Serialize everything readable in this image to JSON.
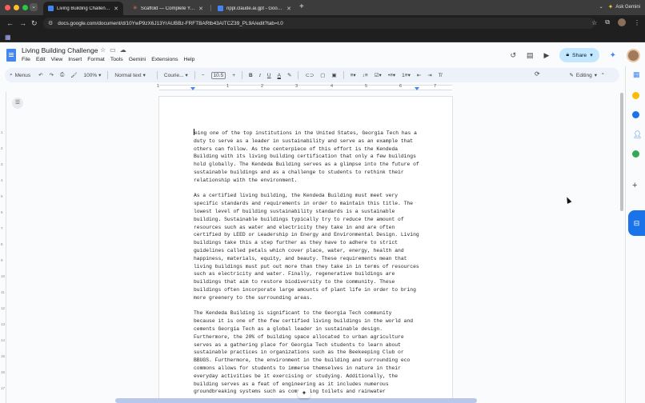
{
  "browser": {
    "tabs": [
      {
        "title": "Living Building Challenge - G",
        "active": true
      },
      {
        "title": "Scaffold — Complete Your W",
        "active": false
      },
      {
        "title": "rippl.claude.ai.gpt - Google",
        "active": false
      }
    ],
    "new_tab_icon": "plus-icon",
    "ask_gemini": "Ask Gemini",
    "url": "docs.google.com/document/d/10YwP9zX6J13YrAUBBz-FRFTBARtb43AITCZ39_PL9A/edit?tab=t.0"
  },
  "doc": {
    "title": "Living Building Challenge",
    "menus": [
      "File",
      "Edit",
      "View",
      "Insert",
      "Format",
      "Tools",
      "Gemini",
      "Extensions",
      "Help"
    ],
    "share_label": "Share"
  },
  "toolbar": {
    "menus_label": "Menus",
    "zoom": "100%",
    "style": "Normal text",
    "font": "Courie...",
    "font_size": "10.5",
    "mode": "Editing",
    "bold": "B",
    "italic": "I",
    "underline": "U",
    "text_color": "A"
  },
  "ruler": {
    "numbers": [
      "1",
      "1",
      "2",
      "3",
      "4",
      "5",
      "6",
      "7"
    ]
  },
  "vruler": {
    "numbers": [
      "1",
      "2",
      "3",
      "4",
      "5",
      "6",
      "7",
      "8",
      "9",
      "10",
      "11",
      "12",
      "13",
      "14",
      "15",
      "16",
      "17",
      "18"
    ]
  },
  "content": {
    "paragraphs": [
      "eing one of the top institutions in the United States, Georgia Tech has a\nduty to serve as a leader in sustainability and serve as an example that\nothers can follow. As the centerpiece of this effort is the Kendeda\nBuilding with its living building certification that only a few buildings\nhold globally. The Kendeda Building serves as a glimpse into the future of\nsustainable buildings and as a challenge to students to rethink their\nrelationship with the environment.",
      "      As a certified living building, the Kendeda Building must meet very\nspecific standards and requirements in order to maintain this title. The\nlowest level of building sustainability standards is a sustainable\nbuilding. Sustainable buildings typically try to reduce the amount of\nresources such as water and electricity they take in and are often\ncertified by LEED or Leadership in Energy and Environmental Design. Living\nbuildings take this a step further as they have to adhere to strict\nguidelines called petals which cover place, water, energy, health and\nhappiness, materials, equity, and beauty. These requirements mean that\nliving buildings must put out more than they take in in terms of resources\nsuch as electricity and water. Finally, regenerative buildings are\nbuildings that aim to restore biodiversity to the community. These\nbuildings often incorporate large amounts of plant life in order to bring\nmore greenery to the surrounding areas.",
      "      The Kendeda Building is significant to the Georgia Tech community\nbecause it is one of the few certified living buildings in the world and\ncements Georgia Tech as a global leader in sustainable design.\nFurthermore, the 20% of building space allocated to urban agriculture\nserves as a gathering place for Georgia Tech students to learn about\nsustainable practices in organizations such as the Beekeeping Club or\nBBUGS. Furthermore, the environment in the building and surrounding eco\ncommons allows for students to immerse themselves in nature in their\neveryday activities be it exercising or studying. Additionally, the\nbuilding serves as a feat of engineering as it includes numerous\ngroundbreaking systems such as    composting toilets and rainwater"
    ]
  }
}
